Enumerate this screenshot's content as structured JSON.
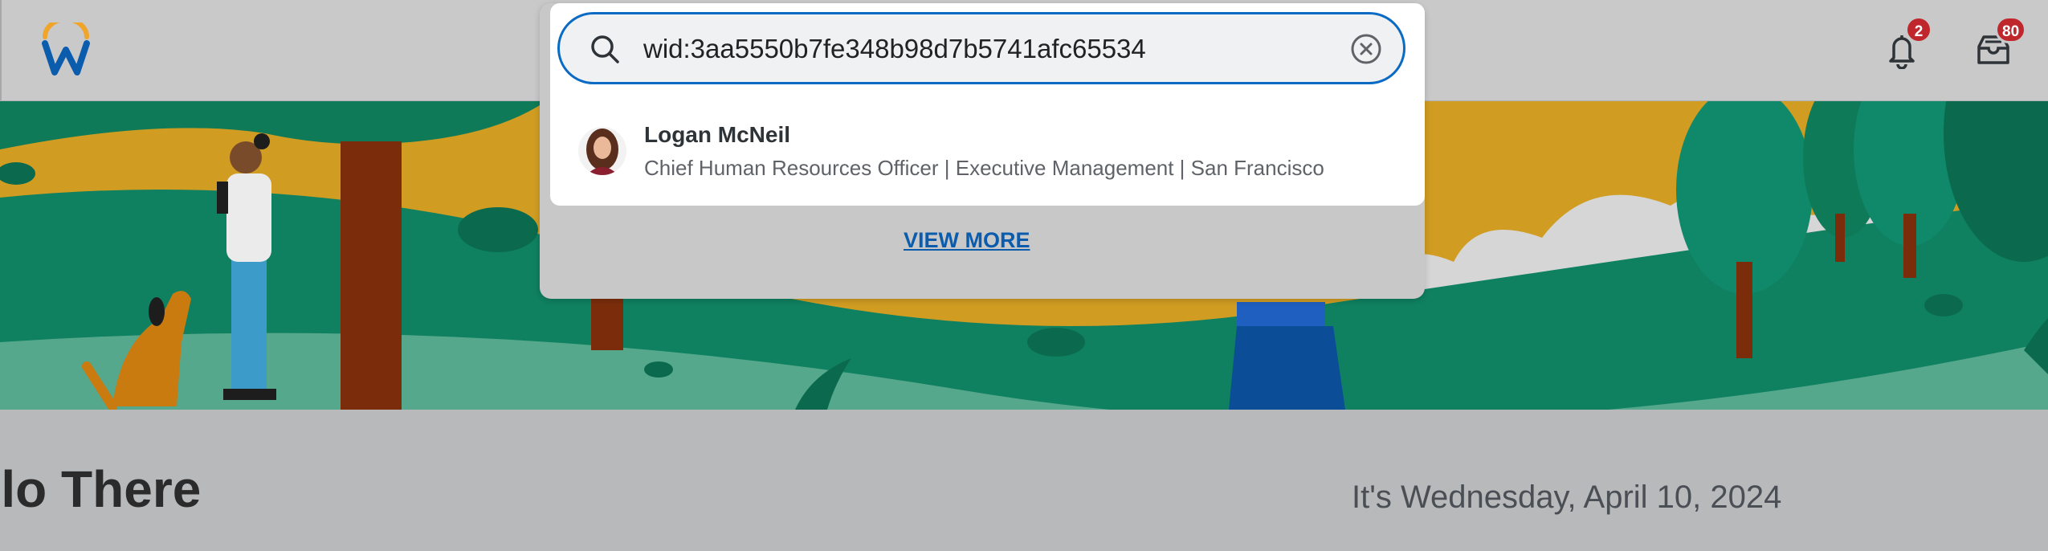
{
  "header": {
    "logo_icon": "workday-w-logo-icon",
    "notifications": {
      "icon": "bell-icon",
      "count": "2"
    },
    "inbox": {
      "icon": "inbox-icon",
      "count": "80"
    }
  },
  "search": {
    "icon": "search-icon",
    "value": "wid:3aa5550b7fe348b98d7b5741afc65534",
    "clear_icon": "clear-circle-x-icon",
    "results": [
      {
        "name": "Logan McNeil",
        "detail": "Chief Human Resources Officer | Executive Management | San Francisco",
        "avatar": "person-avatar"
      }
    ],
    "view_more_label": "VIEW MORE"
  },
  "main": {
    "greeting": "ello There",
    "date": "It's Wednesday, April 10, 2024"
  },
  "colors": {
    "accent_blue": "#0b6bc4",
    "badge_red": "#c0272d",
    "hero_green": "#0f8060",
    "hero_yellow": "#d09c22"
  }
}
